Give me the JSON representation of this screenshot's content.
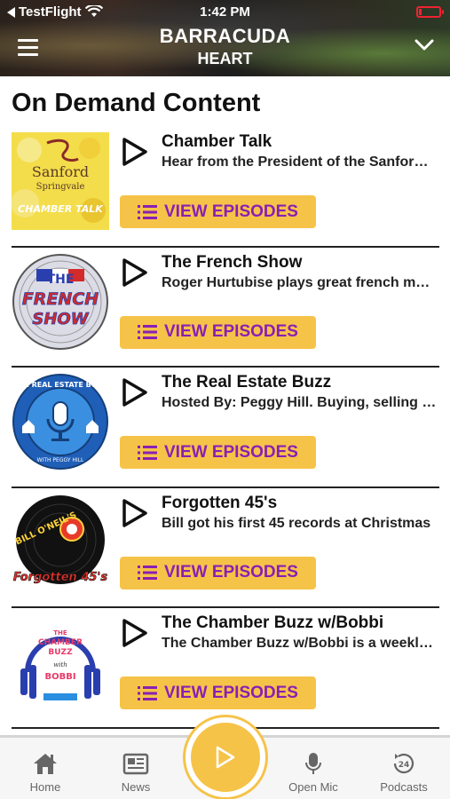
{
  "status_bar": {
    "back_label": "TestFlight",
    "time": "1:42 PM"
  },
  "header": {
    "station_line1": "BARRACUDA",
    "station_line2": "HEART"
  },
  "page_title": "On Demand Content",
  "button_label": "VIEW EPISODES",
  "items": [
    {
      "title": "Chamber Talk",
      "description": "Hear from the President of the Sanford Springvale Chamber of Commerce",
      "logo_text": [
        "Sanford",
        "Springvale",
        "CHAMBER TALK"
      ]
    },
    {
      "title": "The French Show",
      "description": "Roger Hurtubise plays great french music",
      "logo_text": [
        "THE",
        "FRENCH",
        "SHOW"
      ]
    },
    {
      "title": "The Real Estate Buzz",
      "description": "Hosted By: Peggy Hill.  Buying, selling and more",
      "logo_text": [
        "THE REAL ESTATE BUZZ",
        "WITH PEGGY HILL"
      ]
    },
    {
      "title": "Forgotten 45's",
      "description": "Bill got his first 45 records at Christmas",
      "logo_text": [
        "BILL O'NEIL'S",
        "Forgotten 45's"
      ]
    },
    {
      "title": "The Chamber Buzz w/Bobbi",
      "description": "The Chamber Buzz w/Bobbi is a weekly show",
      "logo_text": [
        "THE",
        "CHAMBER",
        "BUZZ",
        "with",
        "BOBBI"
      ]
    }
  ],
  "nav": {
    "home": "Home",
    "news": "News",
    "open_mic": "Open Mic",
    "podcasts": "Podcasts",
    "podcasts_badge": "24"
  },
  "colors": {
    "accent": "#f6c349",
    "button_text": "#8a1fb4",
    "header_bg": "#2a2520"
  }
}
